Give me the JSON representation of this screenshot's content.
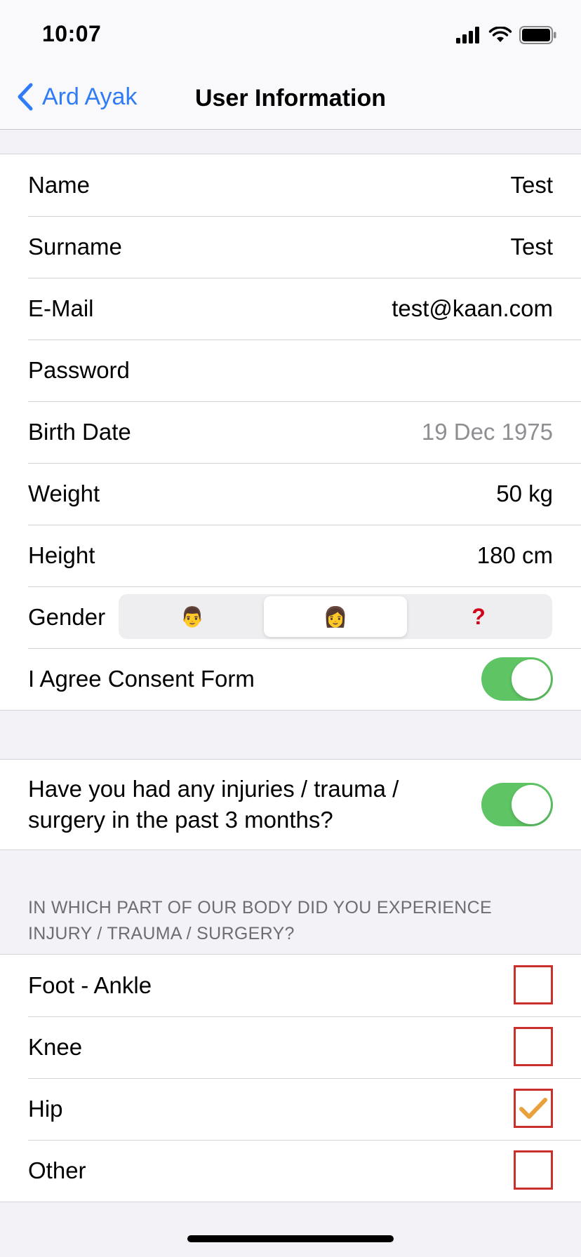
{
  "status_bar": {
    "time": "10:07",
    "icons": [
      "cellular-signal-icon",
      "wifi-icon",
      "battery-icon"
    ]
  },
  "nav": {
    "back_label": "Ard Ayak",
    "back_icon": "chevron-left-icon",
    "title": "User Information"
  },
  "form": {
    "name": {
      "label": "Name",
      "value": "Test"
    },
    "surname": {
      "label": "Surname",
      "value": "Test"
    },
    "email": {
      "label": "E-Mail",
      "value": "test@kaan.com"
    },
    "password": {
      "label": "Password",
      "value": ""
    },
    "birth_date": {
      "label": "Birth Date",
      "value": "19 Dec 1975"
    },
    "weight": {
      "label": "Weight",
      "value": "50 kg"
    },
    "height": {
      "label": "Height",
      "value": "180 cm"
    },
    "gender": {
      "label": "Gender",
      "options": [
        {
          "icon": "man-emoji-icon",
          "glyph": "👨",
          "selected": false
        },
        {
          "icon": "woman-emoji-icon",
          "glyph": "👩",
          "selected": true
        },
        {
          "icon": "question-mark-icon",
          "glyph": "❓",
          "selected": false
        }
      ]
    },
    "consent": {
      "label": "I Agree Consent Form",
      "on": true
    }
  },
  "injury_question": {
    "label": "Have you had any injuries / trauma / surgery in the past 3 months?",
    "on": true
  },
  "body_parts": {
    "header": "IN WHICH PART OF OUR BODY DID YOU EXPERIENCE INJURY / TRAUMA / SURGERY?",
    "items": [
      {
        "label": "Foot - Ankle",
        "checked": false
      },
      {
        "label": "Knee",
        "checked": false
      },
      {
        "label": "Hip",
        "checked": true
      },
      {
        "label": "Other",
        "checked": false
      }
    ]
  },
  "colors": {
    "accent": "#2f7cf6",
    "toggle_on": "#5ec464",
    "checkbox_border": "#c9302c",
    "checkmark": "#e9a23b"
  }
}
